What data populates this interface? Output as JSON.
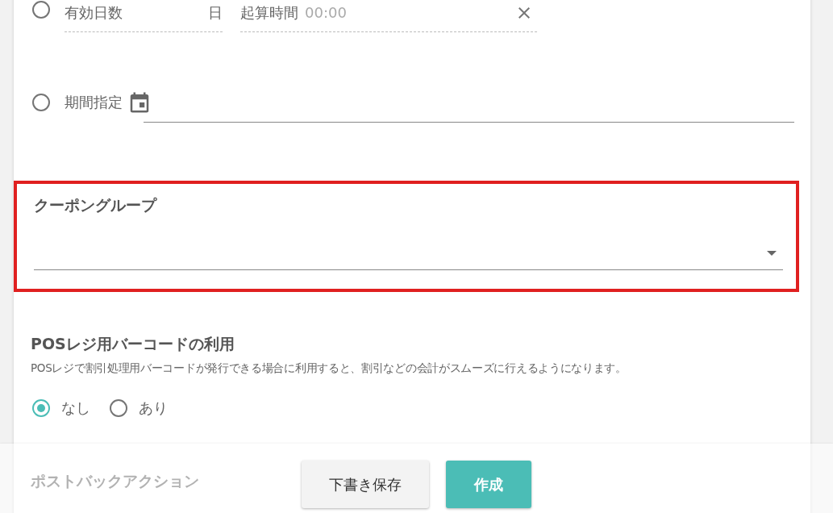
{
  "validity": {
    "options": [
      {
        "kind": "days",
        "selected": false,
        "label": "有効日数",
        "unit": "日",
        "start_label": "起算時間",
        "start_placeholder": "00:00"
      },
      {
        "kind": "period",
        "selected": false,
        "label": "期間指定"
      }
    ]
  },
  "coupon_group": {
    "label": "クーポングループ",
    "highlighted": true
  },
  "pos_barcode": {
    "title": "POSレジ用バーコードの利用",
    "description": "POSレジで割引処理用バーコードが発行できる場合に利用すると、割引などの会計がスムーズに行えるようになります。",
    "options": [
      {
        "label": "なし",
        "selected": true
      },
      {
        "label": "あり",
        "selected": false
      }
    ]
  },
  "postback": {
    "title": "ポストバックアクション"
  },
  "footer": {
    "buttons": [
      {
        "label": "下書き保存",
        "kind": "secondary"
      },
      {
        "label": "作成",
        "kind": "primary"
      }
    ]
  }
}
